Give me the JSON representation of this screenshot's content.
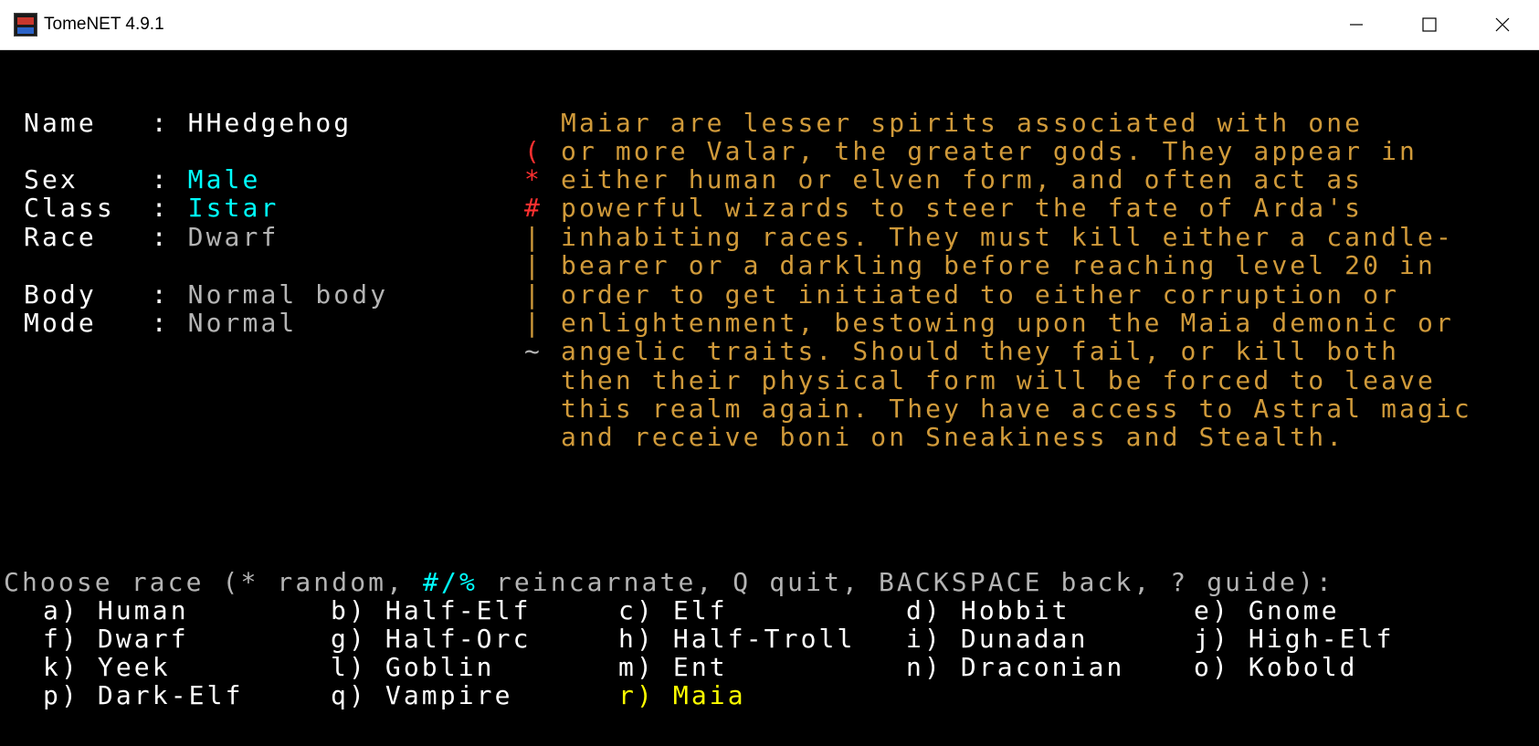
{
  "window": {
    "title": "TomeNET 4.9.1"
  },
  "character": {
    "name_label": "Name   :",
    "name": "HHedgehog",
    "sex_label": "Sex    :",
    "sex": "Male",
    "class_label": "Class  :",
    "class": "Istar",
    "race_label": "Race   :",
    "race": "Dwarf",
    "body_label": "Body   :",
    "body": "Normal body",
    "mode_label": "Mode   :",
    "mode": "Normal"
  },
  "description": {
    "highlight": "Maiar",
    "lines": [
      " are lesser spirits associated with one",
      "or more Valar, the greater gods. They appear in",
      "either human or elven form, and often act as",
      "powerful wizards to steer the fate of Arda's",
      "inhabiting races. They must kill either a candle-",
      "bearer or a darkling before reaching level 20 in",
      "order to get initiated to either corruption or",
      "enlightenment, bestowing upon the Maia demonic or",
      "angelic traits. Should they fail, or kill both",
      "then their physical form will be forced to leave",
      "this realm again. They have access to Astral magic",
      "and receive boni on Sneakiness and Stealth."
    ],
    "side_symbols": [
      "(",
      "*",
      "#",
      "|",
      "|",
      "|",
      "|",
      "~"
    ]
  },
  "prompt": {
    "part1": "Choose race (* random, ",
    "hotkey": "#/%",
    "part2": " reincarnate, Q quit, BACKSPACE back, ? guide):"
  },
  "races": [
    "a) Human",
    "b) Half-Elf",
    "c) Elf",
    "d) Hobbit",
    "e) Gnome",
    "f) Dwarf",
    "g) Half-Orc",
    "h) Half-Troll",
    "i) Dunadan",
    "j) High-Elf",
    "k) Yeek",
    "l) Goblin",
    "m) Ent",
    "n) Draconian",
    "o) Kobold",
    "p) Dark-Elf",
    "q) Vampire",
    "r) Maia"
  ],
  "selected_race": "r) Maia",
  "colors": {
    "label": "#ffffff",
    "value_cyan": "#00ffff",
    "value_gray": "#b4b4b4",
    "description": "#d09a3a",
    "selected": "#ffff00",
    "hotkey": "#00ffff"
  }
}
